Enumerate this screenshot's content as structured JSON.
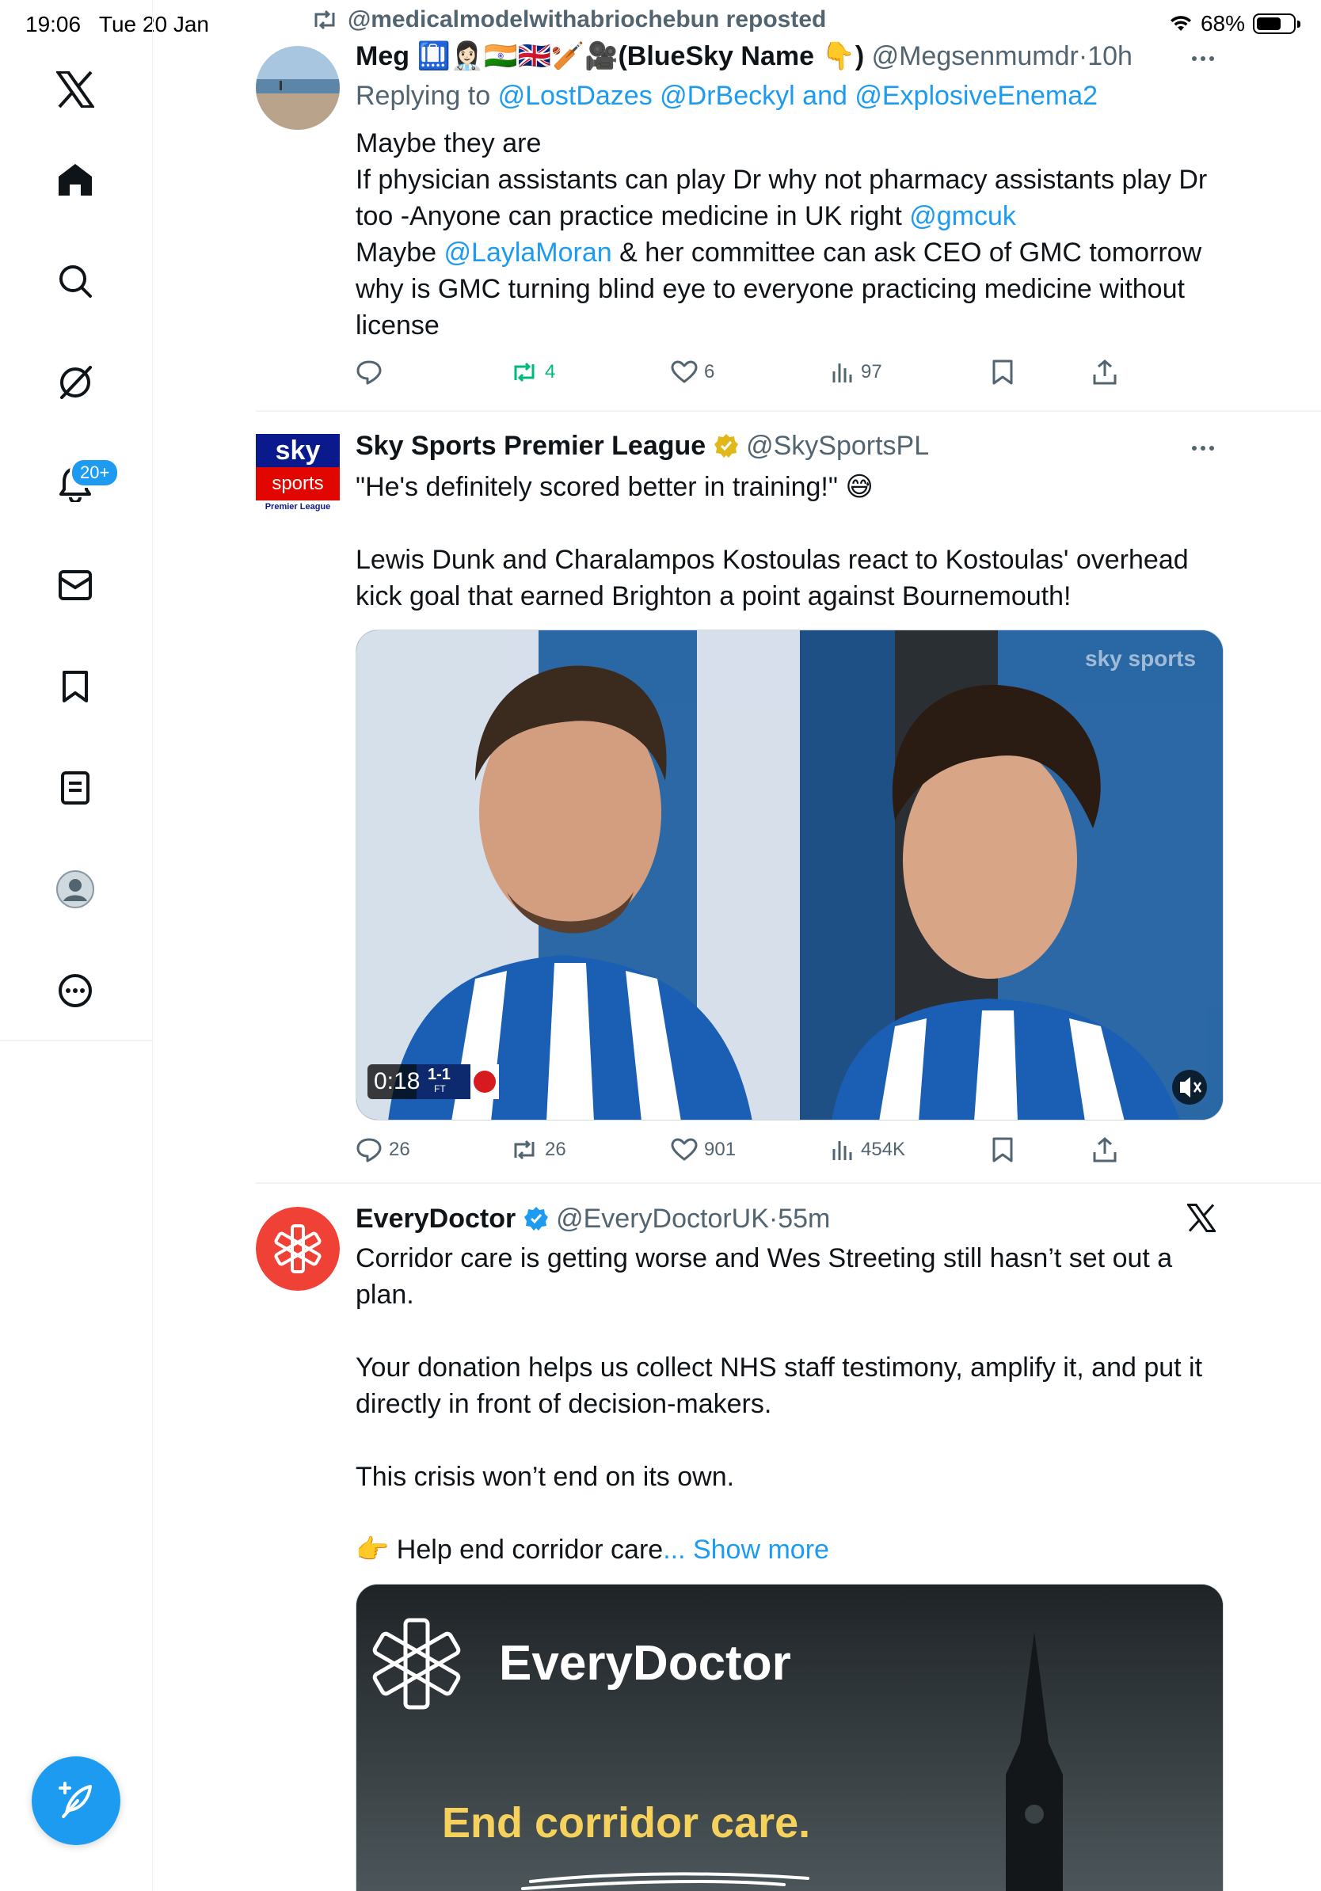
{
  "status": {
    "time": "19:06",
    "date": "Tue 20 Jan",
    "battery": "68%",
    "battery_level": 0.68
  },
  "sidebar": {
    "items": [
      {
        "id": "x-logo",
        "icon": "x-logo-icon"
      },
      {
        "id": "home",
        "icon": "home-icon"
      },
      {
        "id": "explore",
        "icon": "search-icon"
      },
      {
        "id": "grok",
        "icon": "grok-icon"
      },
      {
        "id": "notifications",
        "icon": "bell-icon",
        "badge": "20+"
      },
      {
        "id": "messages",
        "icon": "mail-icon"
      },
      {
        "id": "bookmarks",
        "icon": "bookmark-icon"
      },
      {
        "id": "lists",
        "icon": "list-icon"
      },
      {
        "id": "profile",
        "icon": "profile-icon"
      },
      {
        "id": "more",
        "icon": "more-circle-icon"
      }
    ],
    "compose_icon": "compose-feather-icon"
  },
  "tweets": [
    {
      "repost_label": "@medicalmodelwithabriochebun reposted",
      "name": "Meg",
      "name_suffix": "(BlueSky Name",
      "name_end": ")",
      "handle": "@Megsenmumdr",
      "time": "10h",
      "replying_prefix": "Replying to",
      "replying_to": "@LostDazes @DrBeckyl",
      "replying_and": "and",
      "replying_to_2": "@ExplosiveEnema2",
      "line1": "Maybe they are",
      "line2": "If physician assistants can play Dr why not pharmacy assistants play Dr too -Anyone can practice medicine in UK right",
      "mention1": "@gmcuk",
      "line3_prefix": "Maybe",
      "mention2": "@LaylaMoran",
      "line3": "& her committee can ask CEO of GMC tomorrow why is GMC turning blind eye to everyone practicing medicine without license",
      "stats": {
        "replies": "",
        "reposts": "4",
        "likes": "6",
        "views": "97"
      }
    },
    {
      "name": "Sky Sports Premier League",
      "handle": "@SkySportsPL",
      "avatar_text_1": "sky",
      "avatar_text_2": "sports",
      "avatar_text_3": "Premier League",
      "quote": "\"He's definitely scored better in training!\"",
      "body": "Lewis Dunk and Charalampos Kostoulas react to Kostoulas' overhead kick goal that earned Brighton a point against Bournemouth!",
      "video": {
        "time": "0:18",
        "score": "1-1",
        "status": "FT",
        "watermark": "sky sports"
      },
      "stats": {
        "replies": "26",
        "reposts": "26",
        "likes": "901",
        "views": "454K"
      }
    },
    {
      "name": "EveryDoctor",
      "handle": "@EveryDoctorUK",
      "time": "55m",
      "p1": "Corridor care is getting worse and Wes Streeting still hasn’t set out a plan.",
      "p2": "Your donation helps us collect NHS staff testimony, amplify it, and put it directly in front of decision-makers.",
      "p3": "This crisis won’t end on its own.",
      "p4": "Help end corridor care",
      "show_more": "... Show more",
      "card_brand": "EveryDoctor",
      "card_tagline": "End corridor care."
    }
  ],
  "colors": {
    "accent": "#1d9bf0",
    "repost_green": "#00ba7c",
    "muted": "#536471",
    "sky_red": "#e10600",
    "sky_blue": "#0a1a8c",
    "everydoctor_red": "#ef4136",
    "card_yellow": "#f6d25c"
  }
}
